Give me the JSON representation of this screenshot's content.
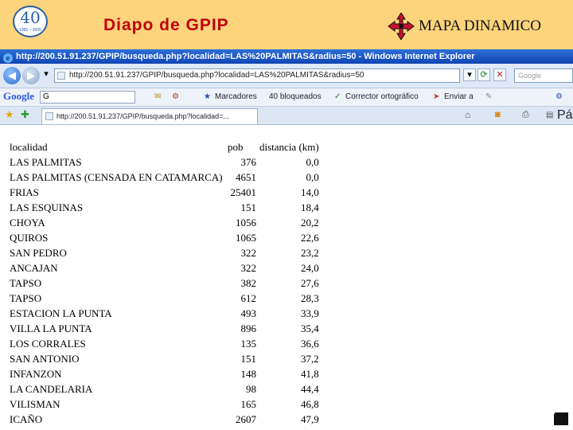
{
  "slide": {
    "logo_number": "40",
    "logo_sub": "1965 – 2005",
    "title": "Diapo de GPIP",
    "brand_text": "MAPA DINAMICO"
  },
  "browser": {
    "window_title": "http://200.51.91.237/GPIP/busqueda.php?localidad=LAS%20PALMITAS&radius=50 - Windows Internet Explorer",
    "address": "http://200.51.91.237/GPIP/busqueda.php?localidad=LAS%20PALMITAS&radius=50",
    "search_placeholder": "Google",
    "toolbar": {
      "google_label": "Google",
      "google_input": "G",
      "marcadores": "Marcadores",
      "bloqueados": "40 bloqueados",
      "corrector": "Corrector ortográfico",
      "enviar": "Enviar a",
      "pagina": "Página"
    },
    "tab_label": "http://200.51.91.237/GPIP/busqueda.php?localidad=..."
  },
  "results": {
    "headers": {
      "localidad": "localidad",
      "pob": "pob",
      "distancia": "distancia (km)"
    },
    "rows": [
      {
        "localidad": "LAS PALMITAS",
        "pob": "376",
        "distancia": "0,0"
      },
      {
        "localidad": "LAS PALMITAS (CENSADA EN CATAMARCA)",
        "pob": "4651",
        "distancia": "0,0"
      },
      {
        "localidad": "FRIAS",
        "pob": "25401",
        "distancia": "14,0"
      },
      {
        "localidad": "LAS ESQUINAS",
        "pob": "151",
        "distancia": "18,4"
      },
      {
        "localidad": "CHOYA",
        "pob": "1056",
        "distancia": "20,2"
      },
      {
        "localidad": "QUIROS",
        "pob": "1065",
        "distancia": "22,6"
      },
      {
        "localidad": "SAN PEDRO",
        "pob": "322",
        "distancia": "23,2"
      },
      {
        "localidad": "ANCAJAN",
        "pob": "322",
        "distancia": "24,0"
      },
      {
        "localidad": "TAPSO",
        "pob": "382",
        "distancia": "27,6"
      },
      {
        "localidad": "TAPSO",
        "pob": "612",
        "distancia": "28,3"
      },
      {
        "localidad": "ESTACION LA PUNTA",
        "pob": "493",
        "distancia": "33,9"
      },
      {
        "localidad": "VILLA LA PUNTA",
        "pob": "896",
        "distancia": "35,4"
      },
      {
        "localidad": "LOS CORRALES",
        "pob": "135",
        "distancia": "36,6"
      },
      {
        "localidad": "SAN ANTONIO",
        "pob": "151",
        "distancia": "37,2"
      },
      {
        "localidad": "INFANZON",
        "pob": "148",
        "distancia": "41,8"
      },
      {
        "localidad": "LA CANDELARIA",
        "pob": "98",
        "distancia": "44,4"
      },
      {
        "localidad": "VILISMAN",
        "pob": "165",
        "distancia": "46,8"
      },
      {
        "localidad": "ICAÑO",
        "pob": "2607",
        "distancia": "47,9"
      }
    ]
  },
  "colors": {
    "header_bg": "#fcd47c",
    "title_red": "#c0000c",
    "titlebar_blue": "#1045b4"
  }
}
